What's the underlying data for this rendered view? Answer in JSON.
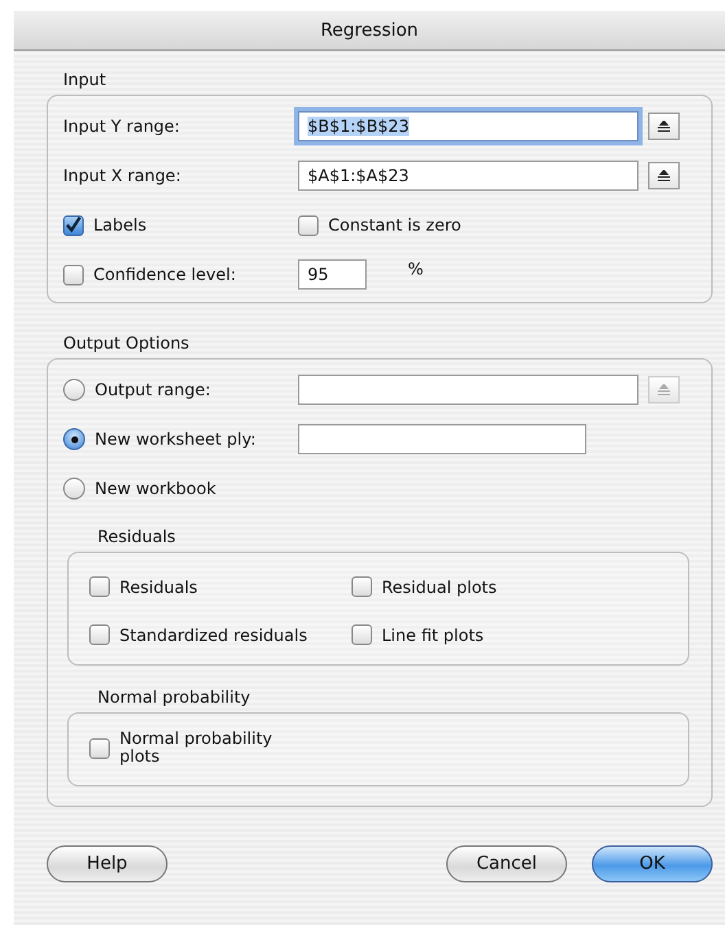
{
  "window": {
    "title": "Regression"
  },
  "input": {
    "label": "Input",
    "ranges": [
      {
        "label": "Input Y range:",
        "value": "$B$1:$B$23",
        "focused": true,
        "button_disabled": false
      },
      {
        "label": "Input X range:",
        "value": "$A$1:$A$23",
        "focused": false,
        "button_disabled": false
      }
    ],
    "labels": {
      "label": "Labels",
      "checked": true
    },
    "constant_zero": {
      "label": "Constant is zero",
      "checked": false
    },
    "confidence": {
      "label": "Confidence level:",
      "checked": false,
      "value": "95",
      "unit": "%"
    }
  },
  "output": {
    "label": "Output Options",
    "options": [
      {
        "kind": "range",
        "label": "Output range:",
        "selected": false,
        "button_disabled": true
      },
      {
        "kind": "text",
        "label": "New worksheet ply:",
        "selected": true
      },
      {
        "kind": "plain",
        "label": "New workbook",
        "selected": false
      }
    ],
    "residuals": {
      "label": "Residuals",
      "items": [
        {
          "label": "Residuals",
          "checked": false
        },
        {
          "label": "Residual plots",
          "checked": false
        },
        {
          "label": "Standardized residuals",
          "checked": false
        },
        {
          "label": "Line fit plots",
          "checked": false
        }
      ]
    },
    "normal": {
      "label": "Normal probability",
      "items": [
        {
          "label": "Normal probability plots",
          "checked": false
        }
      ]
    }
  },
  "buttons": [
    {
      "label": "Help",
      "kind": "help"
    },
    {
      "label": "Cancel",
      "kind": "normal"
    },
    {
      "label": "OK",
      "kind": "default"
    }
  ]
}
